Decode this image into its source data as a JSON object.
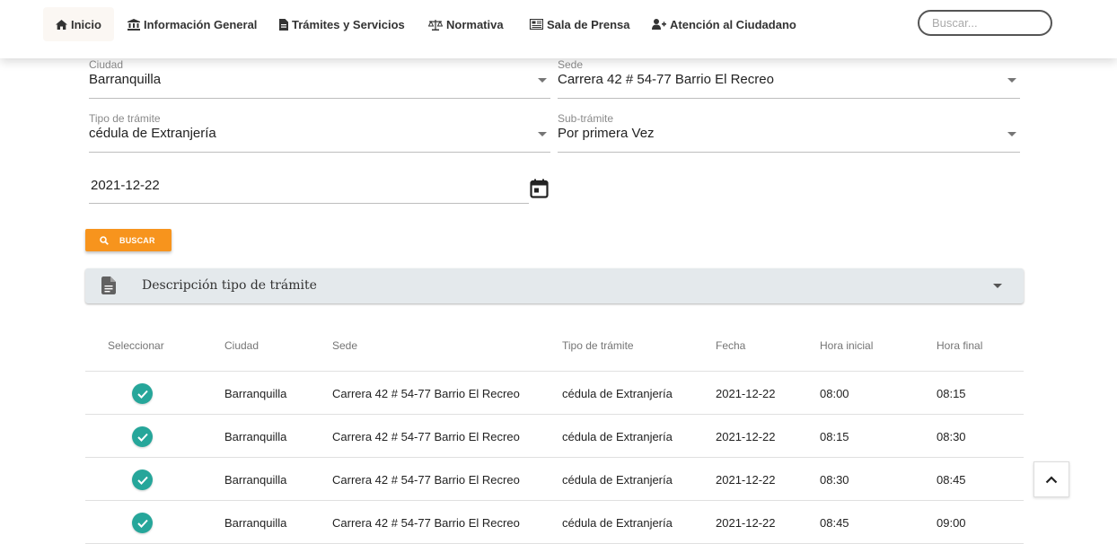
{
  "nav": {
    "items": [
      {
        "label": "Inicio",
        "icon": "home-icon"
      },
      {
        "label": "Información General",
        "icon": "bank-icon"
      },
      {
        "label": "Trámites y Servicios",
        "icon": "file-icon"
      },
      {
        "label": "Normativa",
        "icon": "scale-icon"
      },
      {
        "label": "Sala de Prensa",
        "icon": "newspaper-icon"
      },
      {
        "label": "Atención al Ciudadano",
        "icon": "user-plus-icon"
      }
    ],
    "search_placeholder": "Buscar..."
  },
  "form": {
    "ciudad": {
      "label": "Ciudad",
      "value": "Barranquilla"
    },
    "sede": {
      "label": "Sede",
      "value": "Carrera 42 # 54-77 Barrio El Recreo"
    },
    "tipo": {
      "label": "Tipo de trámite",
      "value": "cédula de Extranjería"
    },
    "subtramite": {
      "label": "Sub-trámite",
      "value": "Por primera Vez"
    },
    "fecha": {
      "value": "2021-12-22"
    },
    "buscar_label": "BUSCAR"
  },
  "accordion": {
    "title": "Descripción tipo de trámite"
  },
  "table": {
    "headers": [
      "Seleccionar",
      "Ciudad",
      "Sede",
      "Tipo de trámite",
      "Fecha",
      "Hora inicial",
      "Hora final"
    ],
    "rows": [
      {
        "ciudad": "Barranquilla",
        "sede": "Carrera 42 # 54-77 Barrio El Recreo",
        "tipo": "cédula de Extranjería",
        "fecha": "2021-12-22",
        "hora_inicial": "08:00",
        "hora_final": "08:15"
      },
      {
        "ciudad": "Barranquilla",
        "sede": "Carrera 42 # 54-77 Barrio El Recreo",
        "tipo": "cédula de Extranjería",
        "fecha": "2021-12-22",
        "hora_inicial": "08:15",
        "hora_final": "08:30"
      },
      {
        "ciudad": "Barranquilla",
        "sede": "Carrera 42 # 54-77 Barrio El Recreo",
        "tipo": "cédula de Extranjería",
        "fecha": "2021-12-22",
        "hora_inicial": "08:30",
        "hora_final": "08:45"
      },
      {
        "ciudad": "Barranquilla",
        "sede": "Carrera 42 # 54-77 Barrio El Recreo",
        "tipo": "cédula de Extranjería",
        "fecha": "2021-12-22",
        "hora_inicial": "08:45",
        "hora_final": "09:00"
      }
    ]
  },
  "colors": {
    "accent": "#f7941d",
    "check": "#26a69a",
    "accordion_bg": "#e4e9ec"
  }
}
